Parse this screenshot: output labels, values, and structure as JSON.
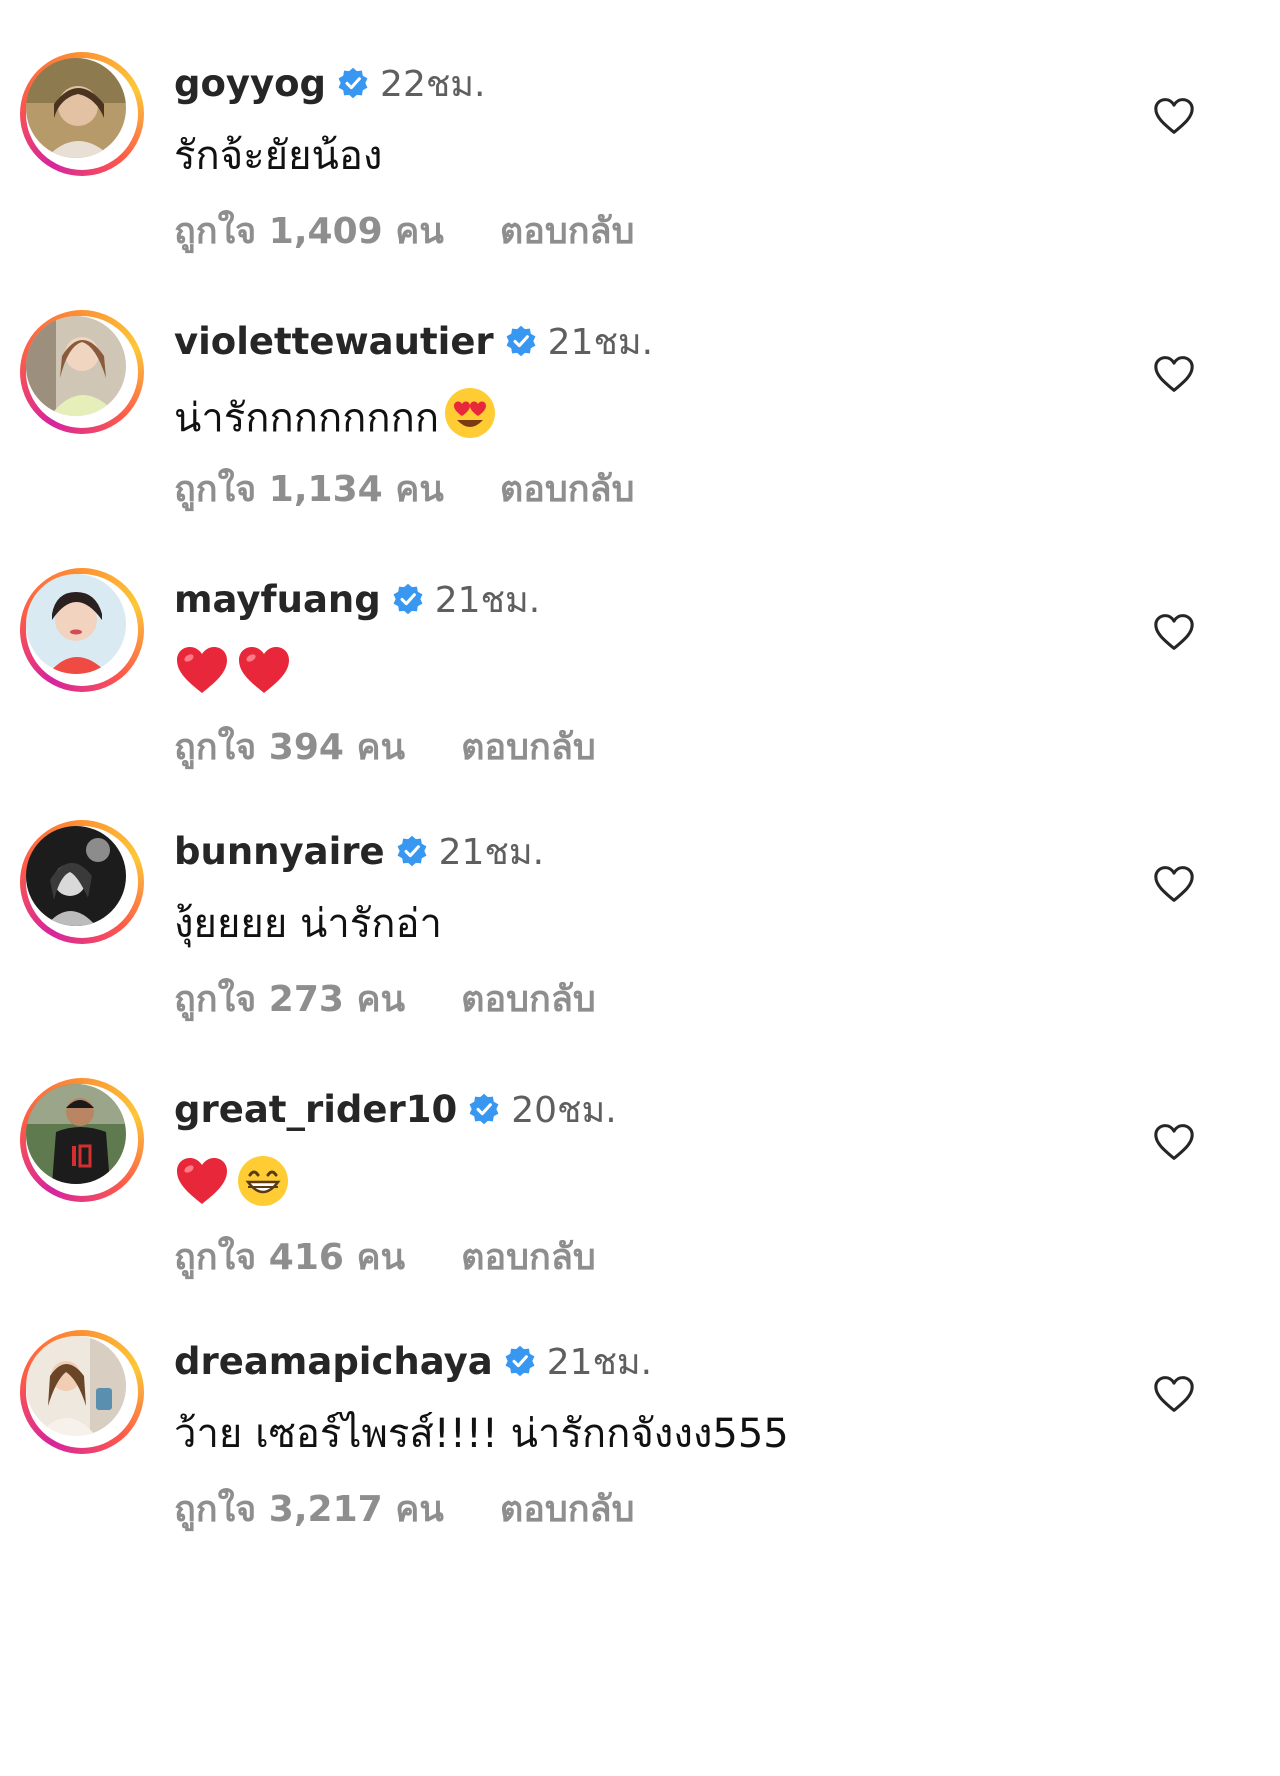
{
  "comments": [
    {
      "username": "goyyog",
      "time": "22ชม.",
      "text": "รักจ้ะยัยน้อง",
      "emojis": [],
      "likes": "ถูกใจ 1,409 คน",
      "reply": "ตอบกลับ"
    },
    {
      "username": "violettewautier",
      "time": "21ชม.",
      "text": "น่ารักกกกกกกก",
      "emojis": [
        "heart-eyes-emoji"
      ],
      "likes": "ถูกใจ 1,134 คน",
      "reply": "ตอบกลับ"
    },
    {
      "username": "mayfuang",
      "time": "21ชม.",
      "text": "",
      "emojis": [
        "red-heart-emoji",
        "red-heart-emoji"
      ],
      "likes": "ถูกใจ 394 คน",
      "reply": "ตอบกลับ"
    },
    {
      "username": "bunnyaire",
      "time": "21ชม.",
      "text": "งุ้ยยยย น่ารักอ่า",
      "emojis": [],
      "likes": "ถูกใจ 273 คน",
      "reply": "ตอบกลับ"
    },
    {
      "username": "great_rider10",
      "time": "20ชม.",
      "text": "",
      "emojis": [
        "red-heart-emoji",
        "grinning-face-emoji"
      ],
      "likes": "ถูกใจ 416 คน",
      "reply": "ตอบกลับ"
    },
    {
      "username": "dreamapichaya",
      "time": "21ชม.",
      "text": "ว้าย เซอร์ไพรส์!!!! น่ารักกจังงง555",
      "emojis": [],
      "likes": "ถูกใจ 3,217 คน",
      "reply": "ตอบกลับ"
    }
  ],
  "icons": {
    "verified": "verified-badge-icon",
    "like": "heart-outline-icon"
  },
  "colors": {
    "verified_blue": "#3897f0",
    "username": "#262626",
    "muted": "#8e8e8e",
    "ring_start": "#d6249f",
    "ring_end": "#fcc838"
  }
}
